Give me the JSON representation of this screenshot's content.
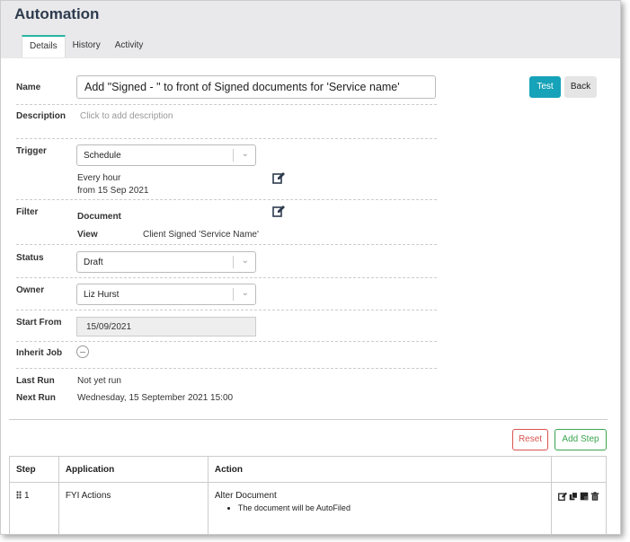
{
  "app": {
    "title": "Automation"
  },
  "tabs": [
    {
      "label": "Details"
    },
    {
      "label": "History"
    },
    {
      "label": "Activity"
    }
  ],
  "form": {
    "name": {
      "label": "Name",
      "value": "Add \"Signed - \" to front of Signed documents for 'Service name'"
    },
    "description": {
      "label": "Description",
      "placeholder": "Click to add description"
    },
    "trigger": {
      "label": "Trigger",
      "selected": "Schedule",
      "frequency": "Every hour",
      "from": "from 15 Sep 2021"
    },
    "filter": {
      "label": "Filter",
      "entity": "Document",
      "view_label": "View",
      "view_value": "Client Signed 'Service Name'"
    },
    "status": {
      "label": "Status",
      "selected": "Draft"
    },
    "owner": {
      "label": "Owner",
      "selected": "Liz Hurst"
    },
    "start_from": {
      "label": "Start From",
      "value": "15/09/2021"
    },
    "inherit_job": {
      "label": "Inherit Job"
    },
    "last_run": {
      "label": "Last Run",
      "value": "Not yet run"
    },
    "next_run": {
      "label": "Next Run",
      "value": "Wednesday, 15 September 2021 15:00"
    }
  },
  "buttons": {
    "test": "Test",
    "back": "Back",
    "reset": "Reset",
    "add_step": "Add Step"
  },
  "steps_table": {
    "headers": {
      "step": "Step",
      "application": "Application",
      "action": "Action"
    },
    "rows": [
      {
        "step": "1",
        "application": "FYI Actions",
        "action": "Alter Document",
        "detail": "The document will be AutoFiled"
      }
    ]
  },
  "colors": {
    "primary": "#16a2b8",
    "danger": "#d9534f",
    "success": "#3aa54e",
    "accent_tab": "#2ab4a0",
    "title": "#2d3b4e"
  }
}
